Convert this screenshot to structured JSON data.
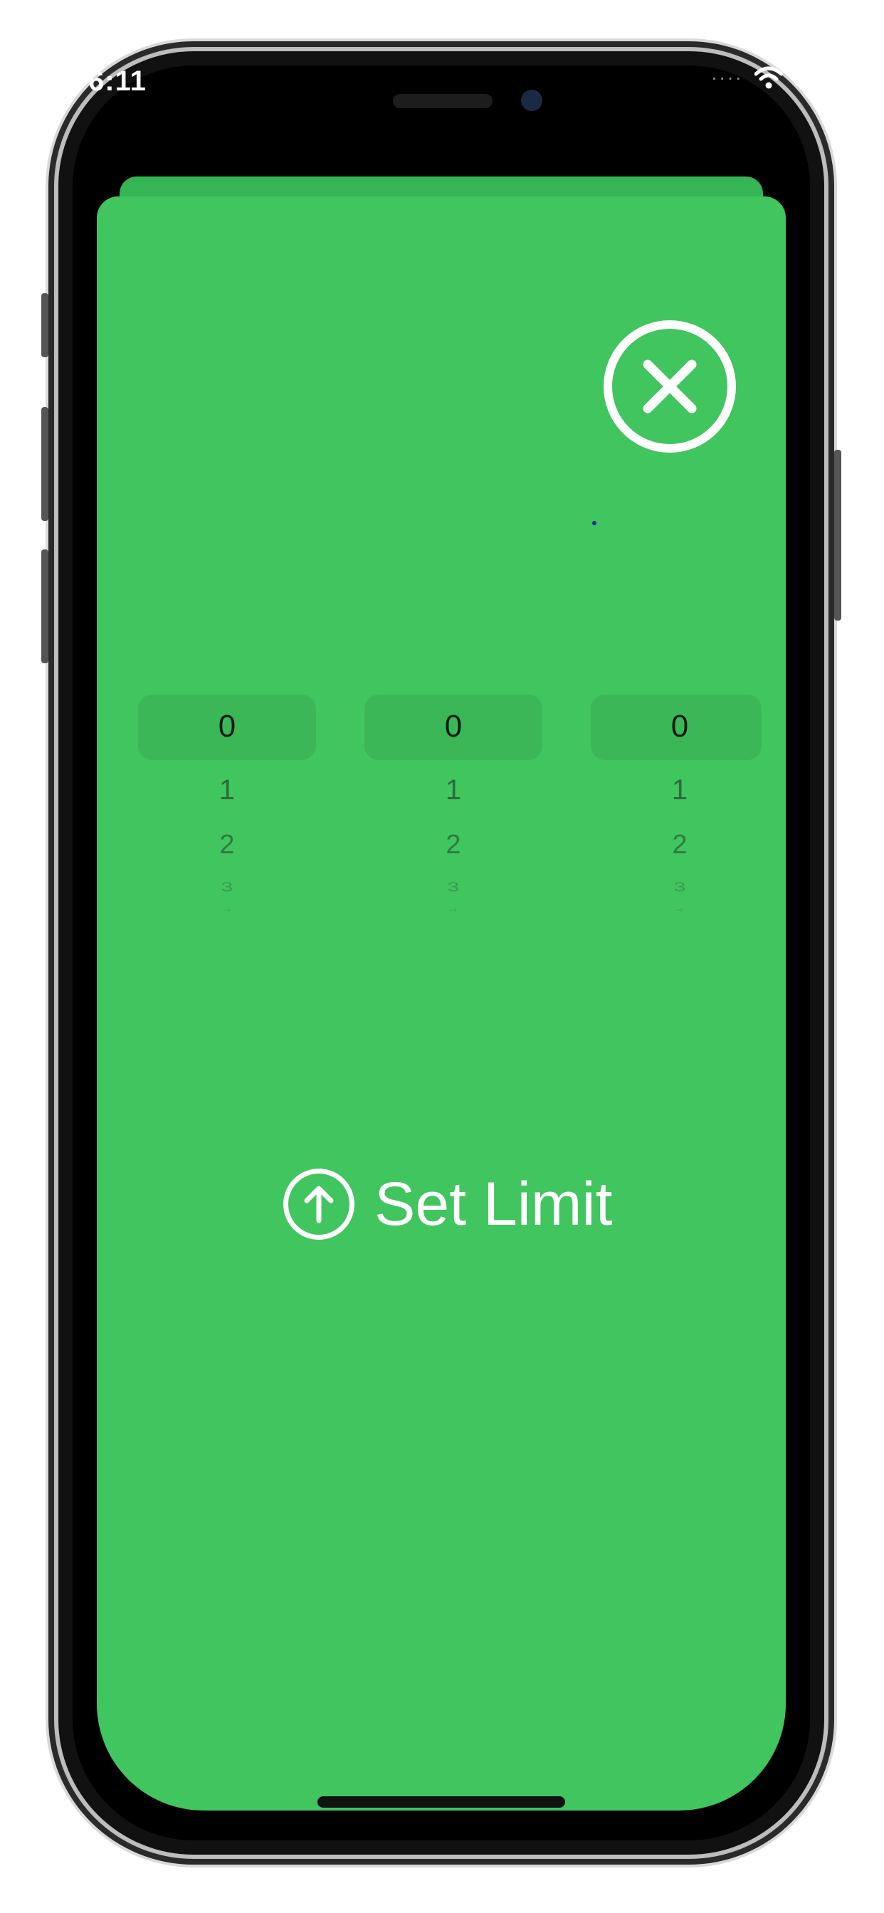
{
  "status_bar": {
    "time": "6:11",
    "signal_icon": "signal-bars-icon",
    "wifi_icon": "wifi-icon",
    "battery_icon": "battery-icon"
  },
  "close_button": {
    "icon": "close-icon"
  },
  "pickers": [
    {
      "selected": "0",
      "items": [
        "1",
        "2",
        "3",
        "4"
      ]
    },
    {
      "selected": "0",
      "items": [
        "1",
        "2",
        "3",
        "4"
      ]
    },
    {
      "selected": "0",
      "items": [
        "1",
        "2",
        "3",
        "4"
      ]
    }
  ],
  "set_limit": {
    "icon": "arrow-up-circle-icon",
    "label": "Set Limit"
  },
  "colors": {
    "sheet": "#41c55f",
    "sheet_back": "#36b556",
    "picker_highlight": "#3cb758",
    "foreground": "#ffffff"
  }
}
